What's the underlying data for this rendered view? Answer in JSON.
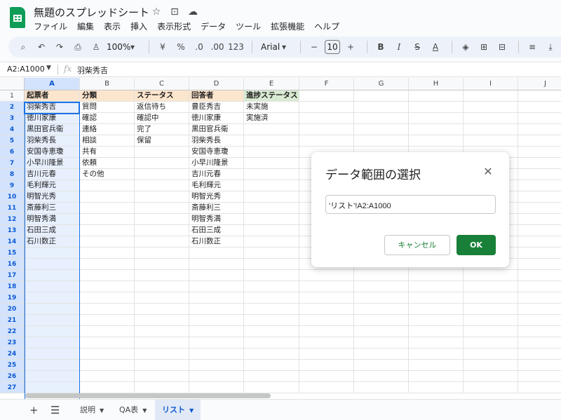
{
  "app": {
    "doc_title": "無題のスプレッドシート",
    "menu": [
      "ファイル",
      "編集",
      "表示",
      "挿入",
      "表示形式",
      "データ",
      "ツール",
      "拡張機能",
      "ヘルプ"
    ]
  },
  "toolbar": {
    "zoom": "100%",
    "currency": "¥",
    "percent": "%",
    "dec_decrease": ".0",
    "dec_increase": ".00",
    "format_123": "123",
    "font": "Arial",
    "font_size": "10",
    "minus": "−",
    "plus": "+",
    "bold": "B",
    "italic": "I",
    "strike": "S",
    "textcolor": "A"
  },
  "formula_bar": {
    "name_box": "A2:A1000",
    "fx": "fx",
    "value": "羽柴秀吉"
  },
  "grid": {
    "columns": [
      "A",
      "B",
      "C",
      "D",
      "E",
      "F",
      "G",
      "H",
      "I",
      "J"
    ],
    "rows": [
      "1",
      "2",
      "3",
      "4",
      "5",
      "6",
      "7",
      "8",
      "9",
      "10",
      "11",
      "12",
      "13",
      "14",
      "15",
      "16",
      "17",
      "18",
      "19",
      "20",
      "21",
      "22",
      "23",
      "24",
      "25",
      "26",
      "27"
    ],
    "headers": [
      "起票者",
      "分類",
      "ステータス",
      "回答者",
      "進捗ステータス"
    ],
    "colA": [
      "羽柴秀吉",
      "徳川家康",
      "黒田官兵衛",
      "羽柴秀長",
      "安国寺恵瓊",
      "小早川隆景",
      "吉川元春",
      "毛利輝元",
      "明智光秀",
      "斎藤利三",
      "明智秀満",
      "石田三成",
      "石川数正"
    ],
    "colB": [
      "質問",
      "確認",
      "連絡",
      "相談",
      "共有",
      "依頼",
      "その他"
    ],
    "colC": [
      "返信待ち",
      "確認中",
      "完了",
      "保留"
    ],
    "colD": [
      "豊臣秀吉",
      "徳川家康",
      "黒田官兵衛",
      "羽柴秀長",
      "安国寺恵瓊",
      "小早川隆景",
      "吉川元春",
      "毛利輝元",
      "明智光秀",
      "斎藤利三",
      "明智秀満",
      "石田三成",
      "石川数正"
    ],
    "colE": [
      "未実施",
      "実施済"
    ]
  },
  "tabs": {
    "items": [
      "説明",
      "QA表",
      "リスト"
    ],
    "active": "リスト"
  },
  "dialog": {
    "title": "データ範囲の選択",
    "range_value": "'リスト'!A2:A1000",
    "cancel_label": "キャンセル",
    "ok_label": "OK"
  },
  "colors": {
    "header_orange": "#fce5cd",
    "header_green": "#d9ead3",
    "selection_blue": "#1a73e8",
    "ok_green": "#188038"
  }
}
